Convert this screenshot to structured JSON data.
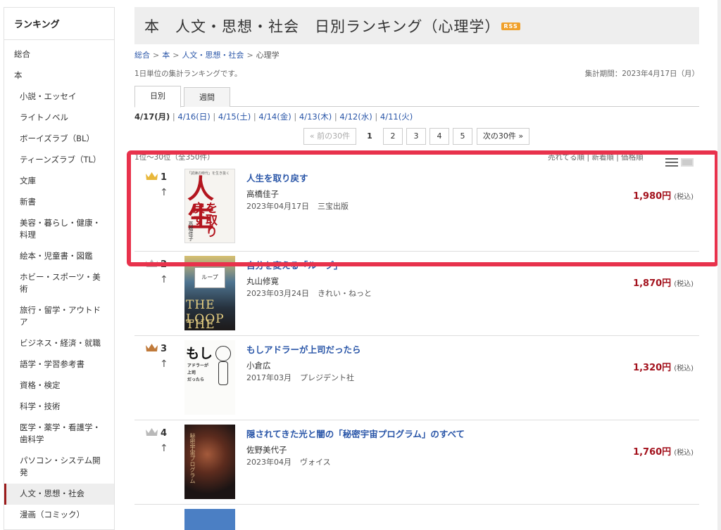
{
  "sidebar": {
    "heading": "ランキング",
    "items": [
      {
        "label": "総合",
        "top": true
      },
      {
        "label": "本",
        "top": true
      },
      {
        "label": "小説・エッセイ"
      },
      {
        "label": "ライトノベル"
      },
      {
        "label": "ボーイズラブ（BL）"
      },
      {
        "label": "ティーンズラブ（TL）"
      },
      {
        "label": "文庫"
      },
      {
        "label": "新書"
      },
      {
        "label": "美容・暮らし・健康・料理"
      },
      {
        "label": "絵本・児童書・図鑑"
      },
      {
        "label": "ホビー・スポーツ・美術"
      },
      {
        "label": "旅行・留学・アウトドア"
      },
      {
        "label": "ビジネス・経済・就職"
      },
      {
        "label": "語学・学習参考書"
      },
      {
        "label": "資格・検定"
      },
      {
        "label": "科学・技術"
      },
      {
        "label": "医学・薬学・看護学・歯科学"
      },
      {
        "label": "パソコン・システム開発"
      },
      {
        "label": "人文・思想・社会",
        "active": true
      },
      {
        "label": "漫画（コミック）"
      }
    ]
  },
  "header": {
    "title": "本　人文・思想・社会　日別ランキング（心理学）",
    "rss": "RSS"
  },
  "breadcrumb": [
    "総合",
    "本",
    "人文・思想・社会",
    "心理学"
  ],
  "unit_note": "1日単位の集計ランキングです。",
  "period": "集計期間：2023年4月17日（月）",
  "tabs": [
    "日別",
    "週間"
  ],
  "dates": {
    "current": "4/17(月)",
    "others": [
      "4/16(日)",
      "4/15(土)",
      "4/14(金)",
      "4/13(木)",
      "4/12(水)",
      "4/11(火)"
    ]
  },
  "pager": {
    "prev": "« 前の30件",
    "current": "1",
    "pages": [
      "2",
      "3",
      "4",
      "5"
    ],
    "next": "次の30件 »"
  },
  "range_text": "1位～30位（全350件）",
  "sort_text": "売れてる順 | 新着順 | 価格順",
  "ranking": [
    {
      "rank": "1",
      "crown_color": "#e8b73a",
      "title": "人生を取り戻す",
      "author": "高橋佳子",
      "date": "2023年04月17日",
      "publisher": "三宝出版",
      "price": "1,980円",
      "tax": "(税込)",
      "cover": {
        "big": "人生",
        "big2": "を取り戻す",
        "author": "高橋佳子",
        "top": "「試練の時代」を生き抜く"
      }
    },
    {
      "rank": "2",
      "crown_color": "#b9b9b9",
      "title": "自分を変える「ループ」",
      "author": "丸山修寛",
      "date": "2023年03月24日",
      "publisher": "きれい・ねっと",
      "price": "1,870円",
      "tax": "(税込)",
      "cover": {
        "box": "ループ",
        "loop": "THE LOOP",
        "loop2": "THE LOOP"
      }
    },
    {
      "rank": "3",
      "crown_color": "#c07a3b",
      "title": "もしアドラーが上司だったら",
      "author": "小倉広",
      "date": "2017年03月",
      "publisher": "プレジデント社",
      "price": "1,320円",
      "tax": "(税込)",
      "cover": {
        "mo": "もし",
        "sub1": "アドラーが",
        "sub2": "上司",
        "sub3": "だったら"
      }
    },
    {
      "rank": "4",
      "crown_color": "#b9b9b9",
      "title": "隠されてきた光と闇の「秘密宇宙プログラム」のすべて",
      "author": "佐野美代子",
      "date": "2023年04月",
      "publisher": "ヴォイス",
      "price": "1,760円",
      "tax": "(税込)",
      "cover": {
        "text": "秘密宇宙プログラム"
      }
    }
  ],
  "up_arrow": "↑"
}
